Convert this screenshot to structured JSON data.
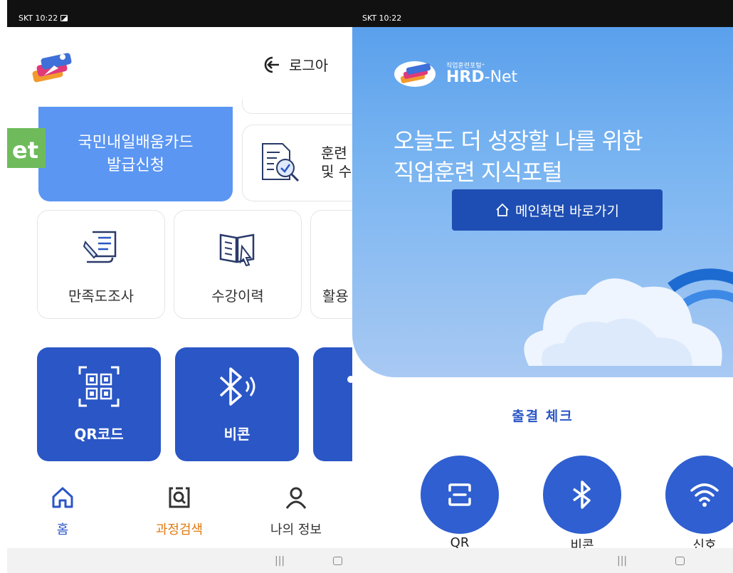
{
  "left": {
    "status": {
      "carrier_time": "SKT 10:22"
    },
    "header": {
      "login_label": "로그아"
    },
    "net_badge": "et",
    "card_apply": {
      "line1": "국민내일배움카드",
      "line2": "발급신청"
    },
    "card_search": {
      "line1": "훈련",
      "line2": "및 수"
    },
    "tiles": [
      {
        "label": "만족도조사",
        "icon": "survey-scroll-icon"
      },
      {
        "label": "수강이력",
        "icon": "book-history-icon"
      },
      {
        "label": "활용",
        "icon": "usage-icon"
      }
    ],
    "buttons": [
      {
        "label": "QR코드",
        "icon": "qr-code-icon"
      },
      {
        "label": "비콘",
        "icon": "bluetooth-icon"
      }
    ],
    "nav": [
      {
        "label": "홈",
        "icon": "home-icon",
        "color": "#2a56c6"
      },
      {
        "label": "과정검색",
        "icon": "search-doc-icon",
        "color": "#e07a12"
      },
      {
        "label": "나의 정보",
        "icon": "person-icon",
        "color": "#333333"
      }
    ]
  },
  "right": {
    "status": {
      "carrier_time": "SKT 10:22"
    },
    "logo": {
      "small": "직업훈련포털⁺",
      "big_a": "HRD",
      "big_b": "-Net"
    },
    "hero_line1": "오늘도 더 성장할 나를 위한",
    "hero_line2": "직업훈련 지식포털",
    "main_button": "메인화면 바로가기",
    "attendance_title": "출결 체크",
    "options": [
      {
        "label": "QR",
        "icon": "qr-scan-icon"
      },
      {
        "label": "비콘",
        "icon": "bluetooth-icon"
      },
      {
        "label": "신호",
        "icon": "wifi-icon"
      }
    ]
  },
  "colors": {
    "primary": "#2a56c6",
    "card_blue": "#5b96f2",
    "net_green": "#6fbb5b",
    "accent_orange": "#e07a12"
  }
}
